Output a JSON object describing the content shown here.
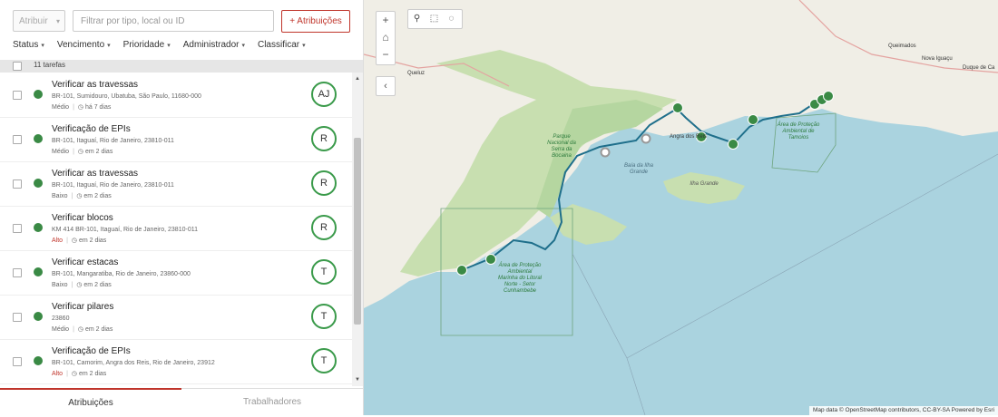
{
  "toolbar": {
    "assign_label": "Atribuir",
    "search_placeholder": "Filtrar por tipo, local ou ID",
    "attributions_label": "+  Atribuições"
  },
  "filters": [
    "Status",
    "Vencimento",
    "Prioridade",
    "Administrador",
    "Classificar"
  ],
  "task_count": "11 tarefas",
  "tasks": [
    {
      "title": "Verificar as travessas",
      "location": "BR-101, Sumidouro, Ubatuba, São Paulo, 11680-000",
      "priority": "Médio",
      "due": "há 7 dias",
      "assignee": "AJ",
      "status_color": "#3a8a45"
    },
    {
      "title": "Verificação de EPIs",
      "location": "BR-101, Itaguaí, Rio de Janeiro, 23810-011",
      "priority": "Médio",
      "due": "em 2 dias",
      "assignee": "R",
      "status_color": "#3a8a45"
    },
    {
      "title": "Verificar as travessas",
      "location": "BR-101, Itaguaí, Rio de Janeiro, 23810-011",
      "priority": "Baixo",
      "due": "em 2 dias",
      "assignee": "R",
      "status_color": "#3a8a45"
    },
    {
      "title": "Verificar blocos",
      "location": "KM 414 BR-101, Itaguaí, Rio de Janeiro, 23810-011",
      "priority": "Alto",
      "due": "em 2 dias",
      "assignee": "R",
      "status_color": "#3a8a45"
    },
    {
      "title": "Verificar estacas",
      "location": "BR-101, Mangaratiba, Rio de Janeiro, 23860-000",
      "priority": "Baixo",
      "due": "em 2 dias",
      "assignee": "T",
      "status_color": "#3a8a45"
    },
    {
      "title": "Verificar pilares",
      "location": "23860",
      "priority": "Médio",
      "due": "em 2 dias",
      "assignee": "T",
      "status_color": "#3a8a45"
    },
    {
      "title": "Verificação de EPIs",
      "location": "BR-101, Camorim, Angra dos Reis, Rio de Janeiro, 23912",
      "priority": "Alto",
      "due": "em 2 dias",
      "assignee": "T",
      "status_color": "#3a8a45"
    }
  ],
  "tabs": {
    "active": "Atribuições",
    "inactive": "Trabalhadores"
  },
  "map": {
    "attribution": "Map data © OpenStreetMap contributors, CC-BY-SA   Powered by Esri",
    "labels": {
      "park": "Parque Nacional da Serra da Bocaina",
      "bay": "Baía da Ilha Grande",
      "island": "Ilha Grande",
      "apa": "Área de Proteção Ambiental Marinha do Litoral Norte - Setor Cunhambebe",
      "apa_tamoios": "Área de Proteção Ambiental de Tamoios",
      "angra": "Angra dos Reis",
      "queluz": "Queluz",
      "nova_iguacu": "Nova Iguaçu",
      "queimados": "Queimados",
      "duque": "Duque de Ca"
    }
  }
}
